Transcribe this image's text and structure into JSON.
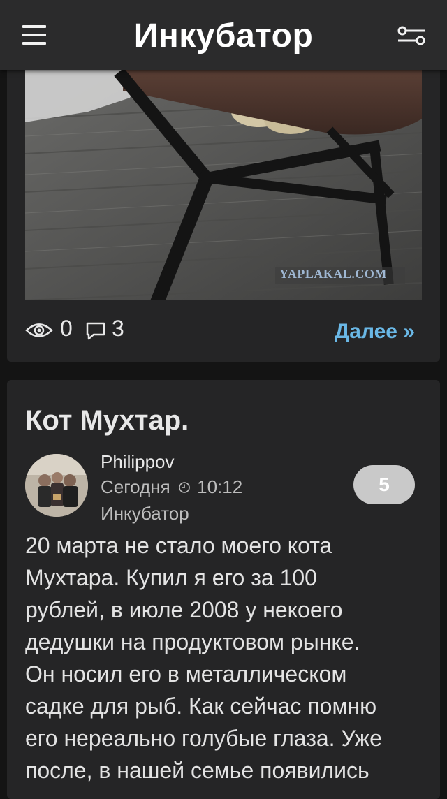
{
  "header": {
    "title": "Инкубатор"
  },
  "icons": {
    "menu": "hamburger-menu-icon",
    "filter": "slider-settings-icon",
    "views": "eye-icon",
    "comments": "comment-bubble-icon",
    "clock": "clock-icon"
  },
  "prev_post": {
    "watermark": "YAPLAKAL.COM",
    "views": "0",
    "comments": "3",
    "more_label": "Далее »"
  },
  "post": {
    "title": "Кот Мухтар.",
    "author": "Philippov",
    "date": "Сегодня",
    "time": "10:12",
    "category": "Инкубатор",
    "rating": "5",
    "text_lines": [
      "20 марта не стало моего кота",
      "Мухтара. Купил я его за 100",
      "рублей, в июле 2008 у некоего",
      "дедушки на продуктовом рынке.",
      "Он носил его в металлическом",
      "садке для рыб. Как сейчас помню",
      "его нереально голубые глаза. Уже",
      "после, в нашей семье появились"
    ]
  },
  "colors": {
    "background": "#141414",
    "header": "#2b2b2c",
    "card": "#252526",
    "link": "#6ab8e6",
    "badge": "#c9c9c9"
  }
}
